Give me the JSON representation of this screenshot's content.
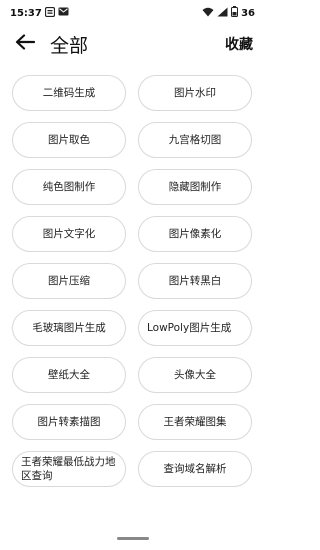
{
  "status_bar": {
    "time": "15:37",
    "left_icons": [
      "notification-icon",
      "mail-icon"
    ],
    "right_icons": [
      "wifi-icon",
      "signal-icon"
    ],
    "battery": "36"
  },
  "app_bar": {
    "back_icon": "arrow-left-icon",
    "title": "全部",
    "action": "收藏"
  },
  "tools": [
    {
      "label": "二维码生成",
      "name": "tool-qrcode"
    },
    {
      "label": "图片水印",
      "name": "tool-watermark"
    },
    {
      "label": "图片取色",
      "name": "tool-color-picker"
    },
    {
      "label": "九宫格切图",
      "name": "tool-nine-grid"
    },
    {
      "label": "纯色图制作",
      "name": "tool-solid-color"
    },
    {
      "label": "隐藏图制作",
      "name": "tool-hidden-image"
    },
    {
      "label": "图片文字化",
      "name": "tool-image-to-text"
    },
    {
      "label": "图片像素化",
      "name": "tool-pixelate"
    },
    {
      "label": "图片压缩",
      "name": "tool-compress"
    },
    {
      "label": "图片转黑白",
      "name": "tool-grayscale"
    },
    {
      "label": "毛玻璃图片生成",
      "name": "tool-frosted-glass"
    },
    {
      "label": "LowPoly图片生成",
      "name": "tool-lowpoly"
    },
    {
      "label": "壁纸大全",
      "name": "tool-wallpapers"
    },
    {
      "label": "头像大全",
      "name": "tool-avatars"
    },
    {
      "label": "图片转素描图",
      "name": "tool-sketch"
    },
    {
      "label": "王者荣耀图集",
      "name": "tool-hok-gallery"
    },
    {
      "label": "王者荣耀最低战力地区查询",
      "name": "tool-hok-region"
    },
    {
      "label": "查询域名解析",
      "name": "tool-dns-lookup"
    }
  ]
}
